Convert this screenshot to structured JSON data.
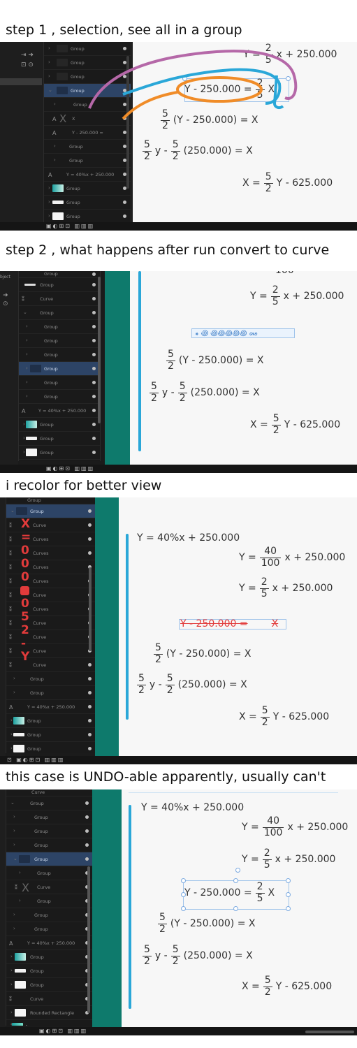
{
  "captions": {
    "step1": "step 1 , selection, see all in a group",
    "step2": "step 2 , what happens after run convert to curve",
    "step3": "i recolor for better view",
    "step4": "this case is UNDO-able apparently, usually can't"
  },
  "math": {
    "y40": "Y = 40%x + 250.000",
    "y_lhs": "Y =",
    "num40": "40",
    "den100": "100",
    "num2": "2",
    "den5": "5",
    "x_plus": "x + 250.000",
    "y_minus": "Y - 250.000 =",
    "x_var": "X",
    "num5": "5",
    "den2": "2",
    "paren_y": "(Y - 250.000) = X",
    "y_minus_small": "y -",
    "paren_const": "(250.000) = X",
    "x_lhs": "X =",
    "y_minus_625": "Y - 625.000",
    "recolored_text": "Y - 250.000 =",
    "recolored_x": "X",
    "garbled": "꘎ ꩜ ꩜꩜꩜꩜꩜ ꘏"
  },
  "layers": {
    "group": "Group",
    "curve": "Curve",
    "curves": "Curves",
    "x_text": "X",
    "y_text": "Y - 250.000 =",
    "formula": "Y = 40%x + 250.000",
    "rounded": "Rounded Rectangle",
    "bg": "bg",
    "object": "bject"
  },
  "red_glyphs": [
    "X",
    "=",
    "0",
    "0",
    "0",
    "",
    "0",
    "5",
    "2",
    "-",
    "Y"
  ],
  "colors": {
    "annot_purple": "#b568a8",
    "annot_blue": "#2aa7d8",
    "annot_orange": "#f08c28",
    "teal": "#0e7a6c",
    "selection": "#2d4466",
    "recolor_red": "#e23b3b"
  }
}
